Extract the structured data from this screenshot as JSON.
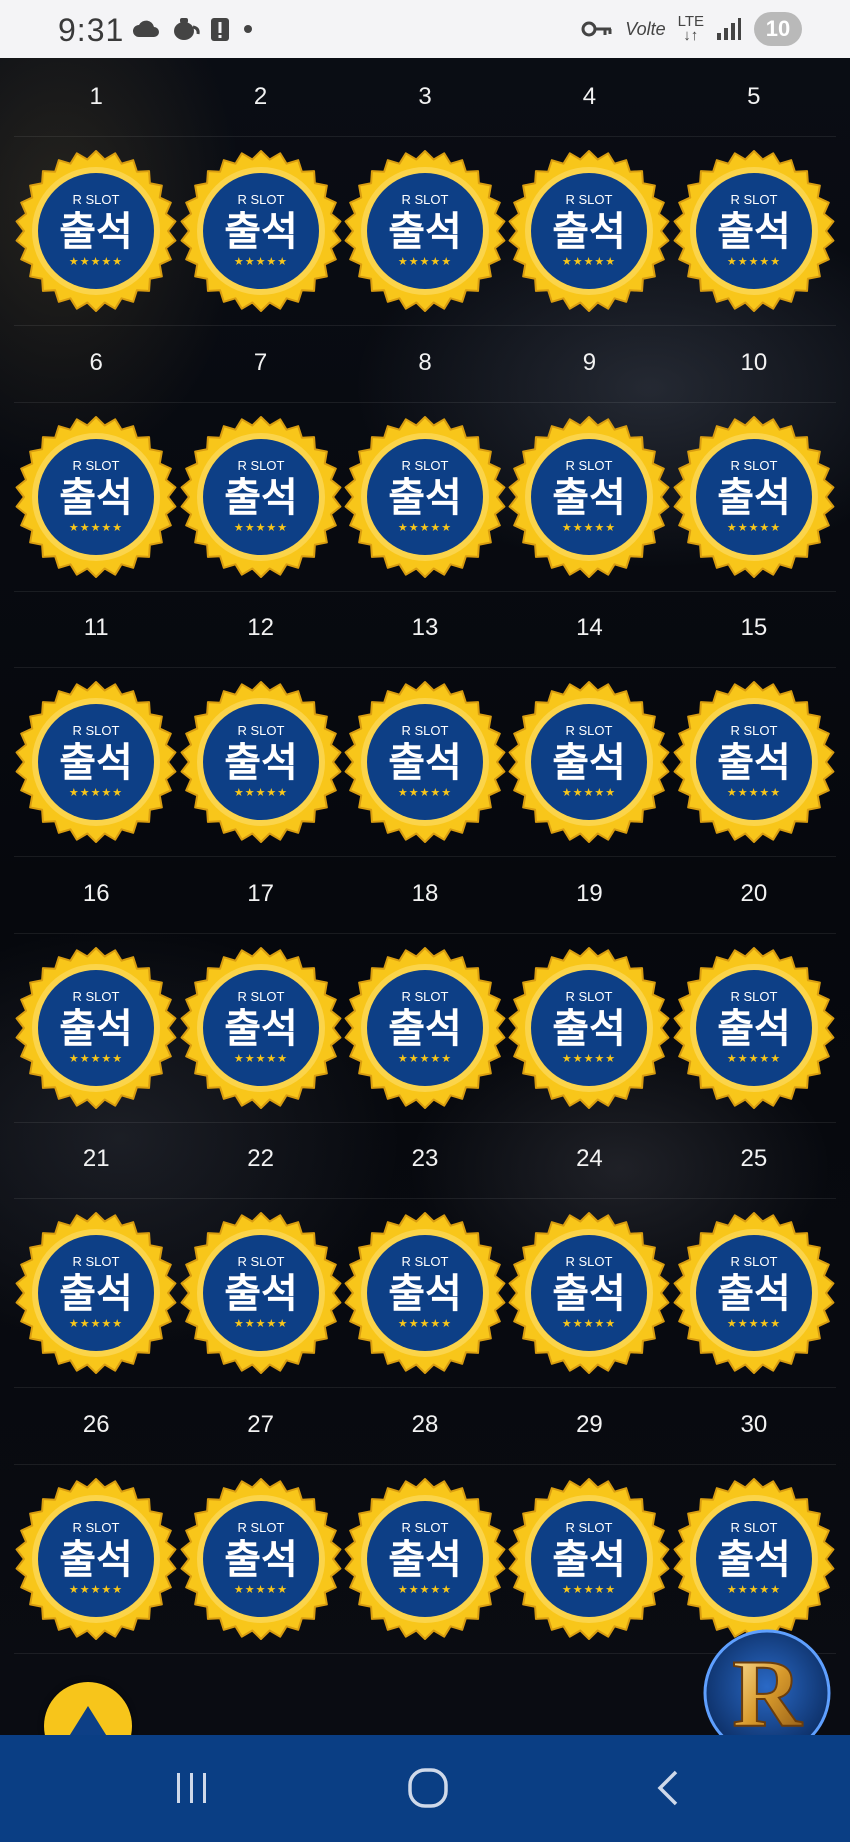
{
  "status_bar": {
    "time": "9:31",
    "left_icons": [
      "cloud-icon",
      "teapot-icon",
      "alert-icon",
      "dot-icon"
    ],
    "carrier_text": "Volte",
    "network": "LTE",
    "battery": "10"
  },
  "calendar": {
    "badge": {
      "top_text": "R SLOT",
      "main_text": "출석",
      "stars": "★★★★★"
    },
    "weeks": [
      {
        "days": [
          "1",
          "2",
          "3",
          "4",
          "5"
        ]
      },
      {
        "days": [
          "6",
          "7",
          "8",
          "9",
          "10"
        ]
      },
      {
        "days": [
          "11",
          "12",
          "13",
          "14",
          "15"
        ]
      },
      {
        "days": [
          "16",
          "17",
          "18",
          "19",
          "20"
        ]
      },
      {
        "days": [
          "21",
          "22",
          "23",
          "24",
          "25"
        ]
      },
      {
        "days": [
          "26",
          "27",
          "28",
          "29",
          "30"
        ]
      }
    ]
  },
  "floating": {
    "scroll_top_icon": "triangle-up-icon",
    "logo_letter": "R"
  },
  "nav_bar": {
    "recent": "recent-apps-icon",
    "home": "home-icon",
    "back": "back-icon"
  },
  "colors": {
    "badge_blue": "#0d3f86",
    "badge_gold": "#f8c61a",
    "nav_blue": "#0a3e84"
  }
}
